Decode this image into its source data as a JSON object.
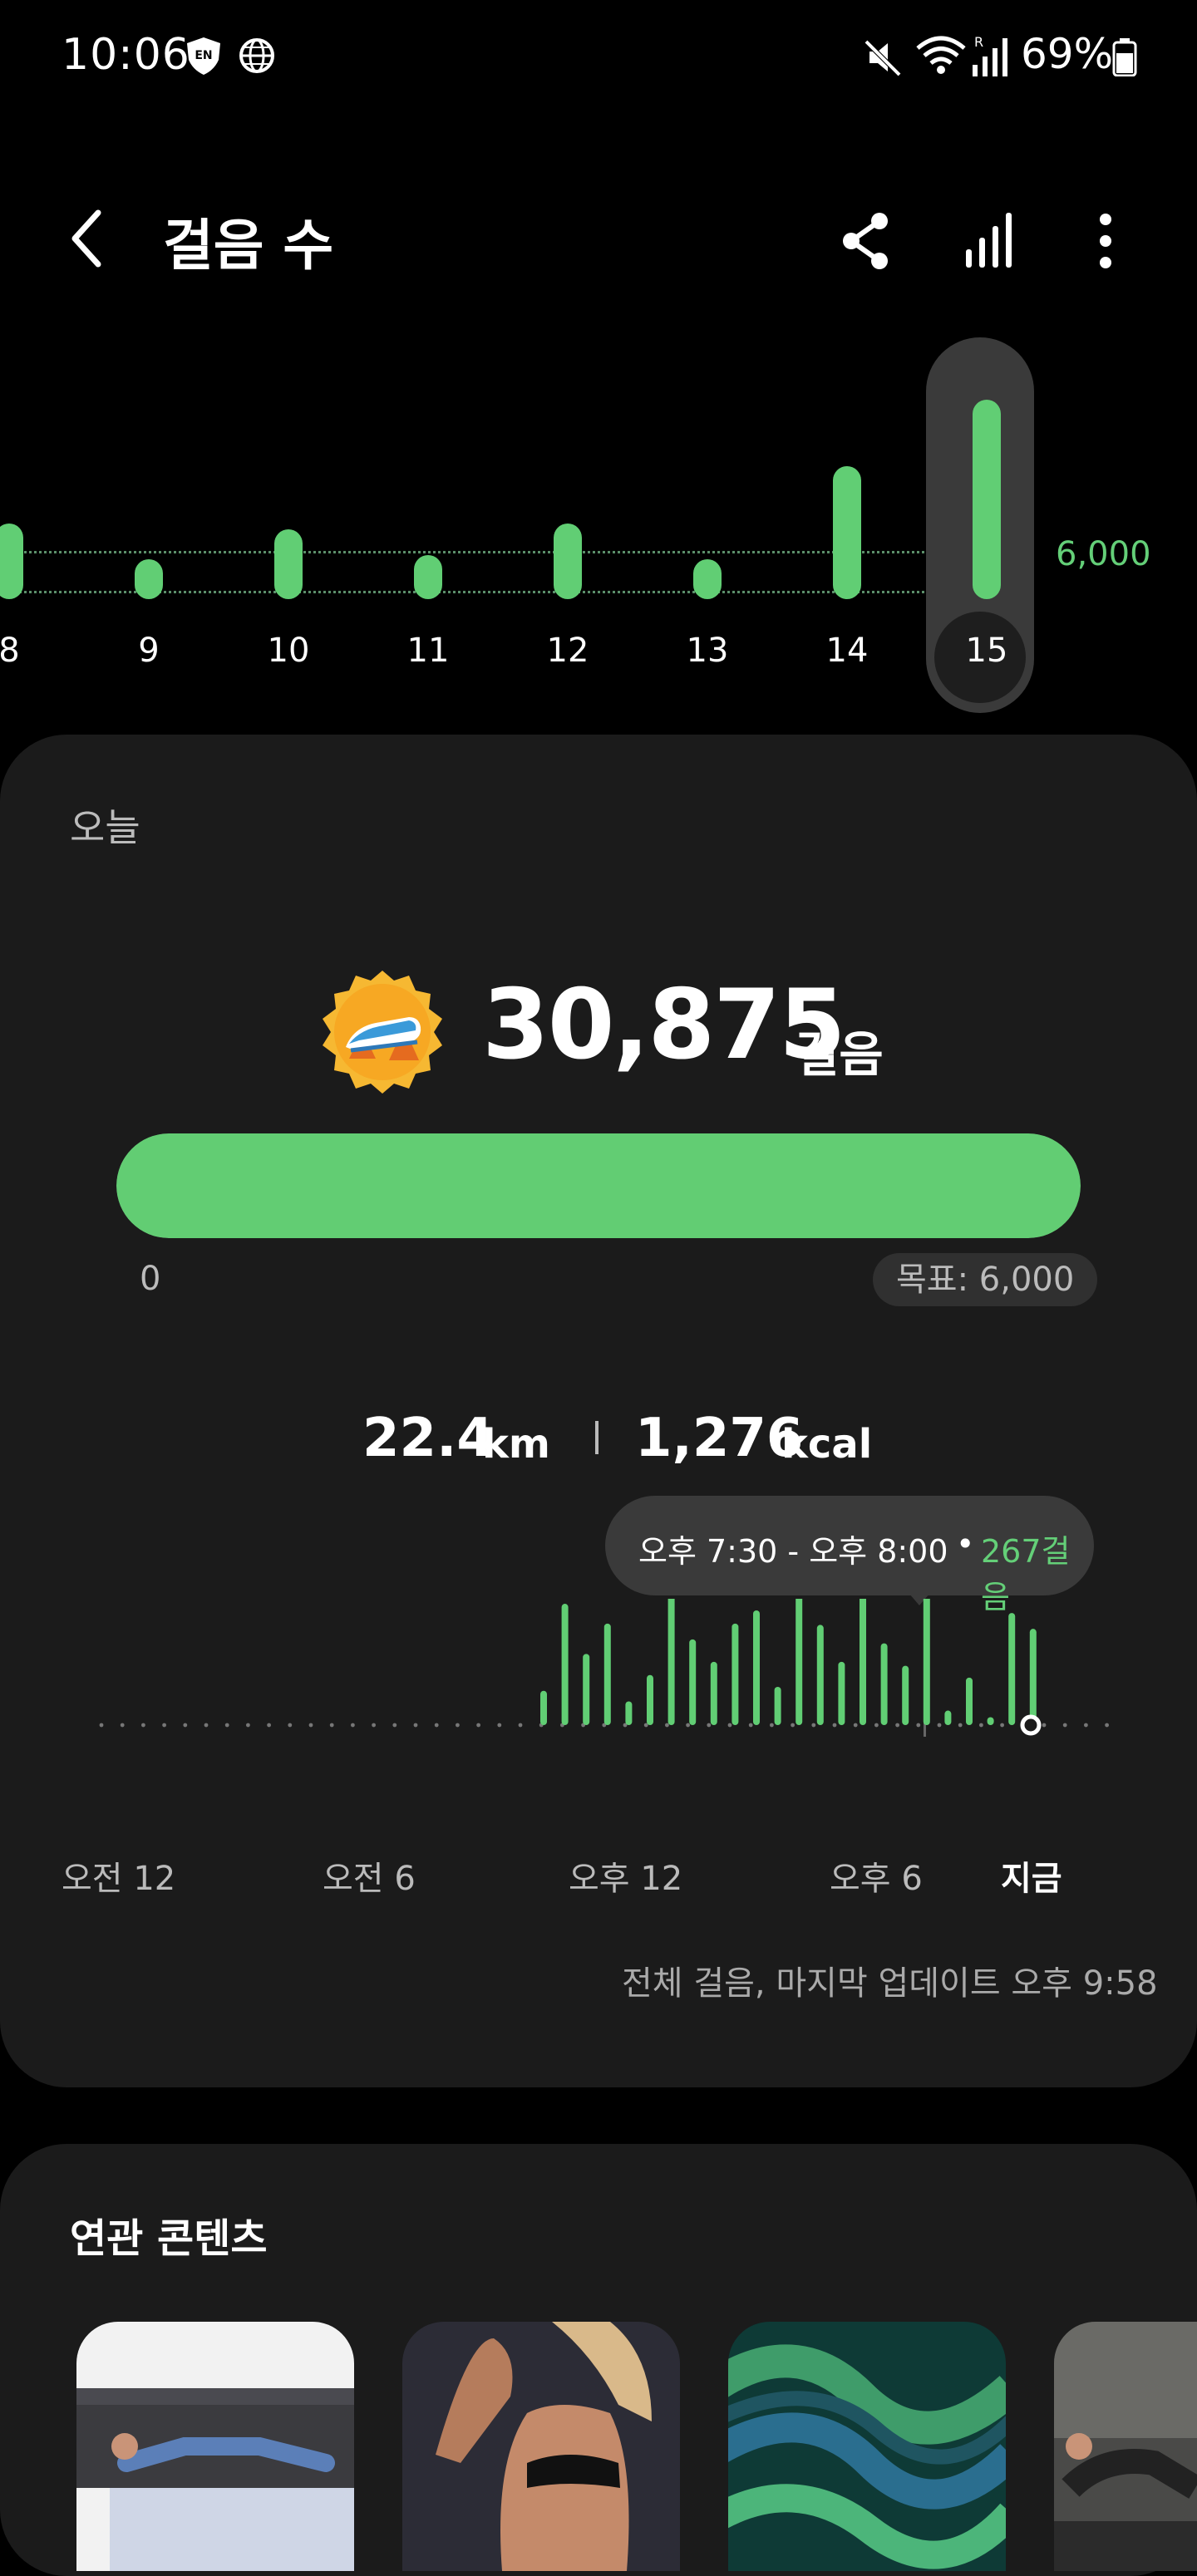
{
  "status_bar": {
    "time": "10:06",
    "battery": "69%",
    "vpn_badge": "EN",
    "icons": [
      "en-shield-icon",
      "globe-icon",
      "mute-icon",
      "wifi-icon",
      "signal-icon",
      "battery-icon"
    ]
  },
  "header": {
    "title": "걸음 수",
    "icons": [
      "back-icon",
      "share-icon",
      "bar-chart-icon",
      "more-vertical-icon"
    ]
  },
  "week": {
    "goal_label": "6,000",
    "goal": 6000,
    "selected_day": "15",
    "days": [
      {
        "label": "8",
        "value": 6000
      },
      {
        "label": "9",
        "value": 1000
      },
      {
        "label": "10",
        "value": 5500
      },
      {
        "label": "11",
        "value": 3500
      },
      {
        "label": "12",
        "value": 6000
      },
      {
        "label": "13",
        "value": 2500
      },
      {
        "label": "14",
        "value": 10500
      },
      {
        "label": "15",
        "value": 30875
      }
    ]
  },
  "today": {
    "label": "오늘",
    "steps": "30,875",
    "steps_unit": "걸음",
    "progress_fraction": 1.0,
    "progress_start": "0",
    "goal_chip": "목표: 6,000",
    "distance_value": "22.4",
    "distance_unit": "km",
    "calories_value": "1,276",
    "calories_unit": "kcal",
    "tooltip": {
      "range": "오후 7:30 - 오후 8:00",
      "dot": "•",
      "steps": "267걸음"
    },
    "axis_labels": [
      "오전 12",
      "오전 6",
      "오후 12",
      "오후 6"
    ],
    "now_label": "지금",
    "updated": "전체 걸음, 마지막 업데이트 오후 9:58",
    "accent": "#61ce74"
  },
  "chart_data": {
    "type": "bar",
    "unit": "steps per 30 min",
    "x": [
      "오전 12",
      "",
      "",
      "",
      "",
      "",
      "",
      "",
      "",
      "",
      "",
      "",
      "오전 6",
      "",
      "",
      "",
      "",
      "",
      "",
      "",
      "",
      "",
      "",
      "",
      "오후 12",
      "",
      "",
      "",
      "",
      "",
      "",
      "",
      "",
      "",
      "",
      "",
      "오후 6",
      "",
      "",
      "",
      "",
      "",
      "",
      "",
      ""
    ],
    "values": [
      0,
      0,
      0,
      0,
      0,
      0,
      0,
      0,
      0,
      0,
      0,
      0,
      0,
      0,
      0,
      0,
      0,
      0,
      0,
      0,
      0,
      0,
      0,
      0,
      0,
      0,
      0,
      0,
      0,
      0,
      0,
      0,
      0,
      0,
      0,
      0,
      0,
      0,
      0,
      0,
      0,
      0,
      0,
      0,
      0,
      0,
      0,
      0,
      0,
      0,
      0,
      0,
      0,
      0,
      0,
      0,
      0,
      0,
      0,
      0,
      0,
      0,
      0,
      0,
      0,
      0,
      0,
      0,
      0,
      0,
      0,
      0,
      0,
      0,
      0,
      0,
      0,
      0,
      0,
      0,
      0,
      0,
      0,
      0,
      0,
      0,
      0,
      0,
      0,
      0,
      0,
      0,
      0,
      0,
      0,
      0
    ]
  },
  "hourly_bars": [
    {
      "slot": 20,
      "value": 260
    },
    {
      "slot": 21,
      "value": 920
    },
    {
      "slot": 22,
      "value": 540
    },
    {
      "slot": 23,
      "value": 770
    },
    {
      "slot": 24,
      "value": 180
    },
    {
      "slot": 25,
      "value": 380
    },
    {
      "slot": 26,
      "value": 1050
    },
    {
      "slot": 27,
      "value": 650
    },
    {
      "slot": 28,
      "value": 480
    },
    {
      "slot": 29,
      "value": 770
    },
    {
      "slot": 30,
      "value": 870
    },
    {
      "slot": 31,
      "value": 290
    },
    {
      "slot": 32,
      "value": 1100
    },
    {
      "slot": 33,
      "value": 760
    },
    {
      "slot": 34,
      "value": 480
    },
    {
      "slot": 35,
      "value": 1240
    },
    {
      "slot": 36,
      "value": 620
    },
    {
      "slot": 37,
      "value": 450
    },
    {
      "slot": 38,
      "value": 1270
    },
    {
      "slot": 39,
      "value": 110
    },
    {
      "slot": 40,
      "value": 360
    },
    {
      "slot": 41,
      "value": 60
    },
    {
      "slot": 42,
      "value": 850
    },
    {
      "slot": 43,
      "value": 730
    }
  ],
  "related": {
    "title": "연관 콘텐츠",
    "thumbnails": [
      "plank-workout-thumbnail",
      "back-muscle-thumbnail",
      "green-swirl-thumbnail",
      "gym-workout-thumbnail"
    ]
  }
}
